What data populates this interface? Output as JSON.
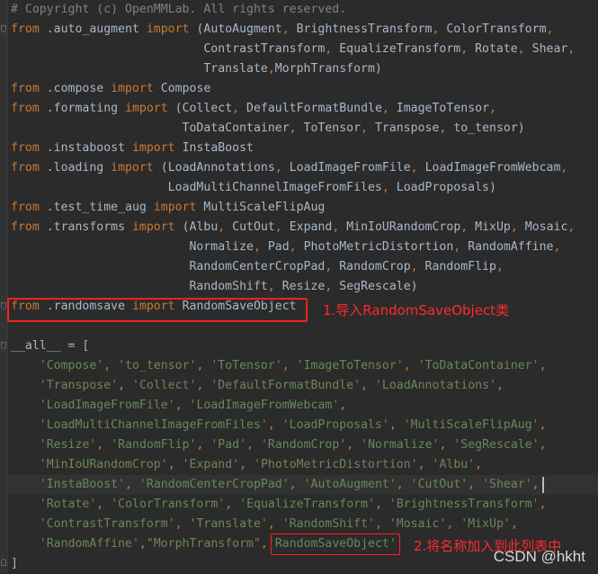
{
  "editor": {
    "colors": {
      "background": "#2b2b2b",
      "keyword": "#cc7832",
      "identifier": "#a9b7c6",
      "string": "#6a8759",
      "comment": "#808080",
      "annotation": "#ff2020"
    },
    "lines": [
      [
        [
          "cm",
          "# Copyright (c) OpenMMLab. All rights reserved."
        ]
      ],
      [
        [
          "kw",
          "from"
        ],
        [
          "pl",
          " .auto_augment "
        ],
        [
          "kw",
          "import"
        ],
        [
          "pl",
          " (AutoAugment"
        ],
        [
          "kw",
          ","
        ],
        [
          "pl",
          " BrightnessTransform"
        ],
        [
          "kw",
          ","
        ],
        [
          "pl",
          " ColorTransform"
        ],
        [
          "kw",
          ","
        ]
      ],
      [
        [
          "pl",
          "                           ContrastTransform"
        ],
        [
          "kw",
          ","
        ],
        [
          "pl",
          " EqualizeTransform"
        ],
        [
          "kw",
          ","
        ],
        [
          "pl",
          " Rotate"
        ],
        [
          "kw",
          ","
        ],
        [
          "pl",
          " Shear"
        ],
        [
          "kw",
          ","
        ]
      ],
      [
        [
          "pl",
          "                           Translate"
        ],
        [
          "kw",
          ","
        ],
        [
          "pl",
          "MorphTransform)"
        ]
      ],
      [
        [
          "kw",
          "from"
        ],
        [
          "pl",
          " .compose "
        ],
        [
          "kw",
          "import"
        ],
        [
          "pl",
          " Compose"
        ]
      ],
      [
        [
          "kw",
          "from"
        ],
        [
          "pl",
          " .formating "
        ],
        [
          "kw",
          "import"
        ],
        [
          "pl",
          " (Collect"
        ],
        [
          "kw",
          ","
        ],
        [
          "pl",
          " DefaultFormatBundle"
        ],
        [
          "kw",
          ","
        ],
        [
          "pl",
          " ImageToTensor"
        ],
        [
          "kw",
          ","
        ]
      ],
      [
        [
          "pl",
          "                        ToDataContainer"
        ],
        [
          "kw",
          ","
        ],
        [
          "pl",
          " ToTensor"
        ],
        [
          "kw",
          ","
        ],
        [
          "pl",
          " Transpose"
        ],
        [
          "kw",
          ","
        ],
        [
          "pl",
          " to_tensor)"
        ]
      ],
      [
        [
          "kw",
          "from"
        ],
        [
          "pl",
          " .instaboost "
        ],
        [
          "kw",
          "import"
        ],
        [
          "pl",
          " InstaBoost"
        ]
      ],
      [
        [
          "kw",
          "from"
        ],
        [
          "pl",
          " .loading "
        ],
        [
          "kw",
          "import"
        ],
        [
          "pl",
          " (LoadAnnotations"
        ],
        [
          "kw",
          ","
        ],
        [
          "pl",
          " LoadImageFromFile"
        ],
        [
          "kw",
          ","
        ],
        [
          "pl",
          " LoadImageFromWebcam"
        ],
        [
          "kw",
          ","
        ]
      ],
      [
        [
          "pl",
          "                      LoadMultiChannelImageFromFiles"
        ],
        [
          "kw",
          ","
        ],
        [
          "pl",
          " LoadProposals)"
        ]
      ],
      [
        [
          "kw",
          "from"
        ],
        [
          "pl",
          " .test_time_aug "
        ],
        [
          "kw",
          "import"
        ],
        [
          "pl",
          " MultiScaleFlipAug"
        ]
      ],
      [
        [
          "kw",
          "from"
        ],
        [
          "pl",
          " .transforms "
        ],
        [
          "kw",
          "import"
        ],
        [
          "pl",
          " (Albu"
        ],
        [
          "kw",
          ","
        ],
        [
          "pl",
          " CutOut"
        ],
        [
          "kw",
          ","
        ],
        [
          "pl",
          " Expand"
        ],
        [
          "kw",
          ","
        ],
        [
          "pl",
          " MinIoURandomCrop"
        ],
        [
          "kw",
          ","
        ],
        [
          "pl",
          " MixUp"
        ],
        [
          "kw",
          ","
        ],
        [
          "pl",
          " Mosaic"
        ],
        [
          "kw",
          ","
        ]
      ],
      [
        [
          "pl",
          "                         Normalize"
        ],
        [
          "kw",
          ","
        ],
        [
          "pl",
          " Pad"
        ],
        [
          "kw",
          ","
        ],
        [
          "pl",
          " PhotoMetricDistortion"
        ],
        [
          "kw",
          ","
        ],
        [
          "pl",
          " RandomAffine"
        ],
        [
          "kw",
          ","
        ]
      ],
      [
        [
          "pl",
          "                         RandomCenterCropPad"
        ],
        [
          "kw",
          ","
        ],
        [
          "pl",
          " RandomCrop"
        ],
        [
          "kw",
          ","
        ],
        [
          "pl",
          " RandomFlip"
        ],
        [
          "kw",
          ","
        ]
      ],
      [
        [
          "pl",
          "                         RandomShift"
        ],
        [
          "kw",
          ","
        ],
        [
          "pl",
          " Resize"
        ],
        [
          "kw",
          ","
        ],
        [
          "pl",
          " SegRescale)"
        ]
      ],
      [
        [
          "kw",
          "from"
        ],
        [
          "pl",
          " .randomsave "
        ],
        [
          "kw",
          "import"
        ],
        [
          "pl",
          " RandomSaveObject"
        ]
      ],
      [],
      [
        [
          "pl",
          "__all__ = ["
        ]
      ],
      [
        [
          "pl",
          "    "
        ],
        [
          "str",
          "'Compose'"
        ],
        [
          "kw",
          ", "
        ],
        [
          "str",
          "'to_tensor'"
        ],
        [
          "kw",
          ", "
        ],
        [
          "str",
          "'ToTensor'"
        ],
        [
          "kw",
          ", "
        ],
        [
          "str",
          "'ImageToTensor'"
        ],
        [
          "kw",
          ", "
        ],
        [
          "str",
          "'ToDataContainer'"
        ],
        [
          "kw",
          ","
        ]
      ],
      [
        [
          "pl",
          "    "
        ],
        [
          "str",
          "'Transpose'"
        ],
        [
          "kw",
          ", "
        ],
        [
          "str",
          "'Collect'"
        ],
        [
          "kw",
          ", "
        ],
        [
          "str",
          "'DefaultFormatBundle'"
        ],
        [
          "kw",
          ", "
        ],
        [
          "str",
          "'LoadAnnotations'"
        ],
        [
          "kw",
          ","
        ]
      ],
      [
        [
          "pl",
          "    "
        ],
        [
          "str",
          "'LoadImageFromFile'"
        ],
        [
          "kw",
          ", "
        ],
        [
          "str",
          "'LoadImageFromWebcam'"
        ],
        [
          "kw",
          ","
        ]
      ],
      [
        [
          "pl",
          "    "
        ],
        [
          "str",
          "'LoadMultiChannelImageFromFiles'"
        ],
        [
          "kw",
          ", "
        ],
        [
          "str",
          "'LoadProposals'"
        ],
        [
          "kw",
          ", "
        ],
        [
          "str",
          "'MultiScaleFlipAug'"
        ],
        [
          "kw",
          ","
        ]
      ],
      [
        [
          "pl",
          "    "
        ],
        [
          "str",
          "'Resize'"
        ],
        [
          "kw",
          ", "
        ],
        [
          "str",
          "'RandomFlip'"
        ],
        [
          "kw",
          ", "
        ],
        [
          "str",
          "'Pad'"
        ],
        [
          "kw",
          ", "
        ],
        [
          "str",
          "'RandomCrop'"
        ],
        [
          "kw",
          ", "
        ],
        [
          "str",
          "'Normalize'"
        ],
        [
          "kw",
          ", "
        ],
        [
          "str",
          "'SegRescale'"
        ],
        [
          "kw",
          ","
        ]
      ],
      [
        [
          "pl",
          "    "
        ],
        [
          "str",
          "'MinIoURandomCrop'"
        ],
        [
          "kw",
          ", "
        ],
        [
          "str",
          "'Expand'"
        ],
        [
          "kw",
          ", "
        ],
        [
          "str",
          "'PhotoMetricDistortion'"
        ],
        [
          "kw",
          ", "
        ],
        [
          "str",
          "'Albu'"
        ],
        [
          "kw",
          ","
        ]
      ],
      [
        [
          "pl",
          "    "
        ],
        [
          "str",
          "'InstaBoost'"
        ],
        [
          "kw",
          ", "
        ],
        [
          "str",
          "'RandomCenterCropPad'"
        ],
        [
          "kw",
          ", "
        ],
        [
          "str",
          "'AutoAugment'"
        ],
        [
          "kw",
          ", "
        ],
        [
          "str",
          "'CutOut'"
        ],
        [
          "kw",
          ", "
        ],
        [
          "str",
          "'Shear'"
        ],
        [
          "kw",
          ","
        ]
      ],
      [
        [
          "pl",
          "    "
        ],
        [
          "str",
          "'Rotate'"
        ],
        [
          "kw",
          ", "
        ],
        [
          "str",
          "'ColorTransform'"
        ],
        [
          "kw",
          ", "
        ],
        [
          "str",
          "'EqualizeTransform'"
        ],
        [
          "kw",
          ", "
        ],
        [
          "str",
          "'BrightnessTransform'"
        ],
        [
          "kw",
          ","
        ]
      ],
      [
        [
          "pl",
          "    "
        ],
        [
          "str",
          "'ContrastTransform'"
        ],
        [
          "kw",
          ", "
        ],
        [
          "str",
          "'Translate'"
        ],
        [
          "kw",
          ", "
        ],
        [
          "str",
          "'RandomShift'"
        ],
        [
          "kw",
          ", "
        ],
        [
          "str",
          "'Mosaic'"
        ],
        [
          "kw",
          ", "
        ],
        [
          "str",
          "'MixUp'"
        ],
        [
          "kw",
          ","
        ]
      ],
      [
        [
          "pl",
          "    "
        ],
        [
          "str",
          "'RandomAffine'"
        ],
        [
          "kw",
          ","
        ],
        [
          "str",
          "\"MorphTransform\""
        ],
        [
          "kw",
          ","
        ],
        [
          "str",
          "'RandomSaveObject'"
        ]
      ],
      [
        [
          "pl",
          "]"
        ]
      ]
    ]
  },
  "annotations": {
    "note1": "1.导入RandomSaveObject类",
    "note2": "2.将名称加入到此列表中"
  },
  "watermark": "CSDN @hkht"
}
